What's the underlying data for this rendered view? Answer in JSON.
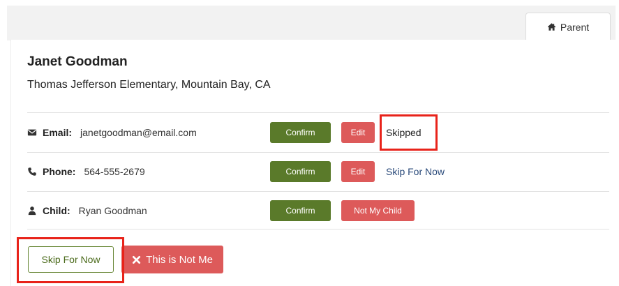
{
  "tab": {
    "label": "Parent",
    "icon": "home-icon"
  },
  "profile": {
    "name": "Janet Goodman",
    "school": "Thomas Jefferson Elementary, Mountain Bay, CA"
  },
  "rows": [
    {
      "icon": "envelope-icon",
      "label": "Email:",
      "value": "janetgoodman@email.com",
      "confirm_label": "Confirm",
      "secondary_label": "Edit",
      "status": "Skipped"
    },
    {
      "icon": "phone-icon",
      "label": "Phone:",
      "value": "564-555-2679",
      "confirm_label": "Confirm",
      "secondary_label": "Edit",
      "skip_label": "Skip For Now"
    },
    {
      "icon": "user-icon",
      "label": "Child:",
      "value": "Ryan Goodman",
      "confirm_label": "Confirm",
      "secondary_label": "Not My Child"
    }
  ],
  "footer": {
    "skip_label": "Skip For Now",
    "not_me_label": "This is Not Me"
  },
  "colors": {
    "confirm": "#5a7a2a",
    "danger": "#dd5a5a",
    "highlight": "#e8231a",
    "link": "#2a4a7a"
  }
}
